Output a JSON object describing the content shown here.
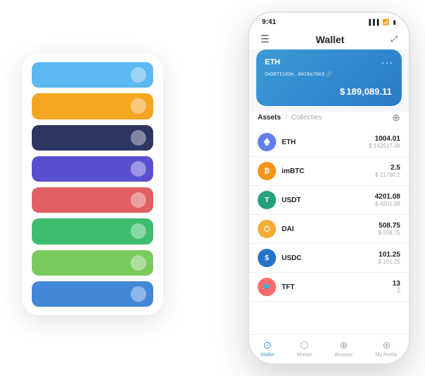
{
  "background_card": {
    "rows": [
      {
        "color": "#5cb8f0"
      },
      {
        "color": "#f5a623"
      },
      {
        "color": "#2d3561"
      },
      {
        "color": "#5a4fcf"
      },
      {
        "color": "#e06060"
      },
      {
        "color": "#3dbe6e"
      },
      {
        "color": "#7bca5e"
      },
      {
        "color": "#4287d8"
      }
    ]
  },
  "status_bar": {
    "time": "9:41",
    "signal": "▐▐▐",
    "wifi": "wifi",
    "battery": "▮"
  },
  "header": {
    "menu_icon": "☰",
    "title": "Wallet",
    "expand_icon": "⤢"
  },
  "eth_card": {
    "title": "ETH",
    "dots": "···",
    "address": "0x08711d3e...8418a78e3  🔗",
    "currency_symbol": "$",
    "balance": "189,089.11"
  },
  "assets_tabs": {
    "active": "Assets",
    "divider": "/",
    "inactive": "Collecties",
    "add_icon": "⊕"
  },
  "assets": [
    {
      "symbol": "ETH",
      "icon_label": "◈",
      "icon_class": "asset-icon-eth",
      "amount": "1004.01",
      "usd": "$ 162517.48"
    },
    {
      "symbol": "imBTC",
      "icon_label": "₿",
      "icon_class": "asset-icon-imbtc",
      "amount": "2.5",
      "usd": "$ 21760.1"
    },
    {
      "symbol": "USDT",
      "icon_label": "₮",
      "icon_class": "asset-icon-usdt",
      "amount": "4201.08",
      "usd": "$ 4201.08"
    },
    {
      "symbol": "DAI",
      "icon_label": "◈",
      "icon_class": "asset-icon-dai",
      "amount": "508.75",
      "usd": "$ 508.75"
    },
    {
      "symbol": "USDC",
      "icon_label": "©",
      "icon_class": "asset-icon-usdc",
      "amount": "101.25",
      "usd": "$ 101.25"
    },
    {
      "symbol": "TFT",
      "icon_label": "🐦",
      "icon_class": "asset-icon-tft",
      "amount": "13",
      "usd": "0"
    }
  ],
  "bottom_nav": [
    {
      "label": "Wallet",
      "icon": "⊙",
      "active": true
    },
    {
      "label": "Market",
      "icon": "⬡",
      "active": false
    },
    {
      "label": "Browser",
      "icon": "⊕",
      "active": false
    },
    {
      "label": "My Profile",
      "icon": "⊛",
      "active": false
    }
  ]
}
